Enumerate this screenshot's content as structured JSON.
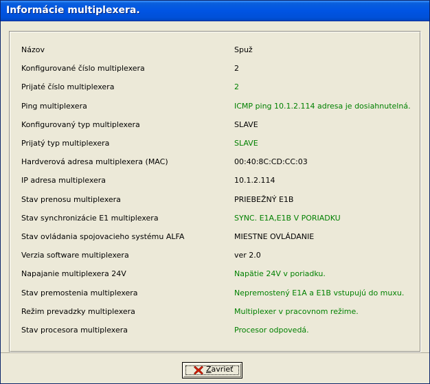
{
  "window": {
    "title": "Informácie multiplexera."
  },
  "rows": [
    {
      "label": "Názov",
      "value": "Spuž",
      "status": "neutral"
    },
    {
      "label": "Konfigurované číslo multiplexera",
      "value": "2",
      "status": "neutral"
    },
    {
      "label": "Prijaté číslo multiplexera",
      "value": "2",
      "status": "ok"
    },
    {
      "label": "Ping multiplexera",
      "value": "ICMP ping 10.1.2.114 adresa je dosiahnutelná.",
      "status": "ok"
    },
    {
      "label": "Konfigurovaný typ multiplexera",
      "value": "SLAVE",
      "status": "neutral"
    },
    {
      "label": "Prijatý typ multiplexera",
      "value": "SLAVE",
      "status": "ok"
    },
    {
      "label": "Hardverová adresa multiplexera (MAC)",
      "value": "00:40:8C:CD:CC:03",
      "status": "neutral"
    },
    {
      "label": "IP adresa multiplexera",
      "value": "10.1.2.114",
      "status": "neutral"
    },
    {
      "label": "Stav prenosu multiplexera",
      "value": "PRIEBEŽNÝ E1B",
      "status": "neutral"
    },
    {
      "label": "Stav synchronizácie E1 multiplexera",
      "value": "SYNC. E1A,E1B V PORIADKU",
      "status": "ok"
    },
    {
      "label": "Stav ovládania spojovacieho systému ALFA",
      "value": "MIESTNE OVLÁDANIE",
      "status": "neutral"
    },
    {
      "label": "Verzia software multiplexera",
      "value": "ver 2.0",
      "status": "neutral"
    },
    {
      "label": "Napajanie multiplexera 24V",
      "value": "Napätie 24V v poriadku.",
      "status": "ok"
    },
    {
      "label": "Stav premostenia multiplexera",
      "value": "Nepremostený E1A a E1B vstupujú do muxu.",
      "status": "ok"
    },
    {
      "label": "Režim prevadzky multiplexera",
      "value": "Multiplexer v pracovnom režime.",
      "status": "ok"
    },
    {
      "label": "Stav procesora multiplexera",
      "value": "Procesor odpovedá.",
      "status": "ok"
    }
  ],
  "colors": {
    "ok": "#008000",
    "neutral": "#000000",
    "title_bg": "#0054e3"
  },
  "close_button": {
    "label_first": "Z",
    "label_rest": "avrieť",
    "icon": "red-x-icon"
  }
}
